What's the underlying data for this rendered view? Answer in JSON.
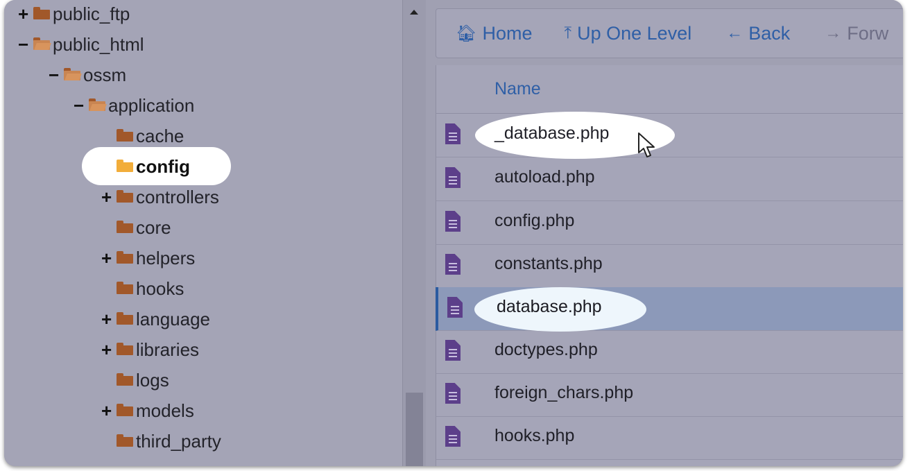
{
  "tree": {
    "items": [
      {
        "toggle": "+",
        "label": "public_ftp",
        "icon": "folder-closed-icon"
      },
      {
        "toggle": "−",
        "label": "public_html",
        "icon": "folder-open-icon"
      },
      {
        "toggle": "−",
        "label": "ossm",
        "icon": "folder-open-icon"
      },
      {
        "toggle": "−",
        "label": "application",
        "icon": "folder-open-icon"
      },
      {
        "toggle": "",
        "label": "cache",
        "icon": "folder-closed-icon"
      },
      {
        "toggle": "",
        "label": "config",
        "icon": "folder-active-icon",
        "selected": true
      },
      {
        "toggle": "+",
        "label": "controllers",
        "icon": "folder-closed-icon"
      },
      {
        "toggle": "",
        "label": "core",
        "icon": "folder-closed-icon"
      },
      {
        "toggle": "+",
        "label": "helpers",
        "icon": "folder-closed-icon"
      },
      {
        "toggle": "",
        "label": "hooks",
        "icon": "folder-closed-icon"
      },
      {
        "toggle": "+",
        "label": "language",
        "icon": "folder-closed-icon"
      },
      {
        "toggle": "+",
        "label": "libraries",
        "icon": "folder-closed-icon"
      },
      {
        "toggle": "",
        "label": "logs",
        "icon": "folder-closed-icon"
      },
      {
        "toggle": "+",
        "label": "models",
        "icon": "folder-closed-icon"
      },
      {
        "toggle": "",
        "label": "third_party",
        "icon": "folder-closed-icon"
      }
    ]
  },
  "toolbar": {
    "home_label": "Home",
    "up_label": "Up One Level",
    "back_label": "Back",
    "forward_label": "Forw"
  },
  "table": {
    "header_name": "Name",
    "files": [
      {
        "name": "_database.php",
        "icon": "php-file-icon"
      },
      {
        "name": "autoload.php",
        "icon": "php-file-icon"
      },
      {
        "name": "config.php",
        "icon": "php-file-icon"
      },
      {
        "name": "constants.php",
        "icon": "php-file-icon"
      },
      {
        "name": "database.php",
        "icon": "php-file-icon",
        "selected": true
      },
      {
        "name": "doctypes.php",
        "icon": "php-file-icon"
      },
      {
        "name": "foreign_chars.php",
        "icon": "php-file-icon"
      },
      {
        "name": "hooks.php",
        "icon": "php-file-icon"
      }
    ]
  },
  "colors": {
    "accent": "#2f5fa6",
    "folder": "#a1582a",
    "folder_active": "#f2ad3a",
    "file_icon": "#5c3f8a",
    "selected_row": "#8c99b9"
  }
}
